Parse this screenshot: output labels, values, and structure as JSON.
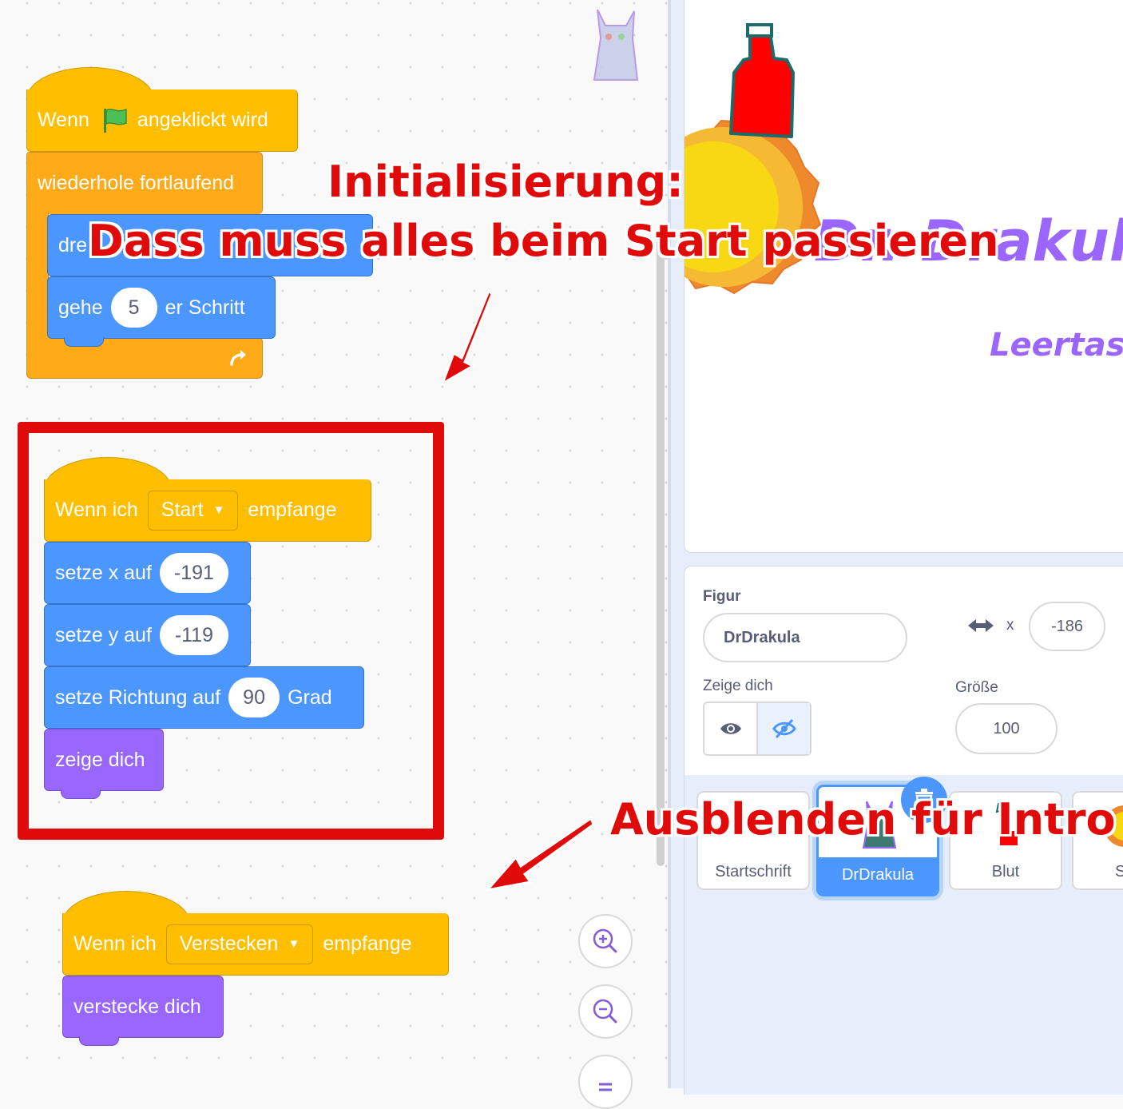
{
  "blocks": {
    "script1": {
      "hat_text_before": "Wenn",
      "hat_text_after": "angeklickt wird",
      "forever_label": "wiederhole fortlaufend",
      "turn_label": "dre",
      "move_label": "gehe",
      "move_value": "5",
      "move_suffix": "er Schritt"
    },
    "script2": {
      "hat_prefix": "Wenn ich",
      "hat_dropdown": "Start",
      "hat_suffix": "empfange",
      "set_x_label": "setze x auf",
      "set_x_value": "-191",
      "set_y_label": "setze y auf",
      "set_y_value": "-119",
      "direction_label": "setze Richtung auf",
      "direction_value": "90",
      "direction_suffix": "Grad",
      "show_label": "zeige dich"
    },
    "script3": {
      "hat_prefix": "Wenn ich",
      "hat_dropdown": "Verstecken",
      "hat_suffix": "empfange",
      "hide_label": "verstecke dich"
    }
  },
  "annotations": {
    "title_line1": "Initialisierung:",
    "title_line2": "Dass muss alles beim Start passieren",
    "bottom": "Ausblenden für Intro"
  },
  "stage": {
    "title_text": "Dr. Drakula",
    "subtitle_text": "Leertaste"
  },
  "sprite_info": {
    "sprite_label": "Figur",
    "sprite_name": "DrDrakula",
    "x_label": "x",
    "x_value": "-186",
    "show_label": "Zeige dich",
    "size_label": "Größe",
    "size_value": "100"
  },
  "sprites": [
    {
      "name": "Startschrift"
    },
    {
      "name": "DrDrakula"
    },
    {
      "name": "Blut"
    },
    {
      "name": "S"
    }
  ],
  "colors": {
    "events": "#ffbf00",
    "control": "#ffab19",
    "motion": "#4c97ff",
    "looks": "#9966ff",
    "annotation_red": "#e10a0a",
    "selected_sprite": "#4c97ff",
    "stage_text_purple": "#9a66ff"
  },
  "icons": [
    "green-flag-icon",
    "loop-arrow-icon",
    "dropdown-arrow-icon",
    "zoom-in-icon",
    "zoom-out-icon",
    "zoom-reset-icon",
    "eye-icon",
    "eye-slash-icon",
    "arrows-horizontal-icon",
    "trash-icon",
    "close-icon"
  ]
}
